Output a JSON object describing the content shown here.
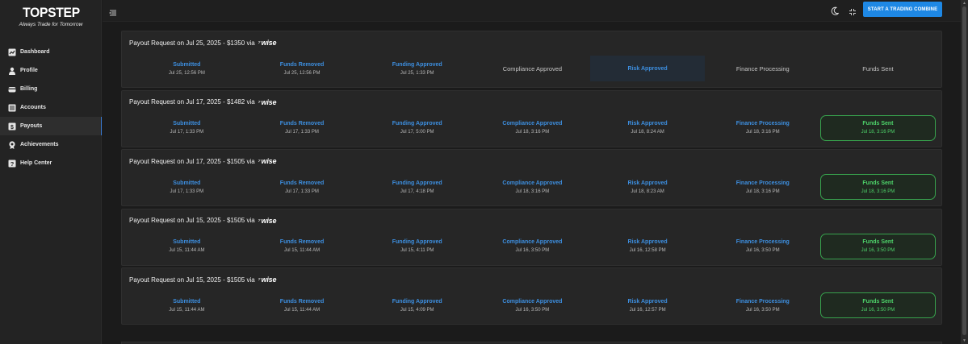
{
  "brand": {
    "name": "TOPSTEP",
    "tagline": "Always Trade for Tomorrow"
  },
  "nav": [
    {
      "label": "Dashboard",
      "icon": "chart-icon",
      "active": false
    },
    {
      "label": "Profile",
      "icon": "user-icon",
      "active": false
    },
    {
      "label": "Billing",
      "icon": "billing-icon",
      "active": false
    },
    {
      "label": "Accounts",
      "icon": "list-icon",
      "active": false
    },
    {
      "label": "Payouts",
      "icon": "payout-icon",
      "active": true
    },
    {
      "label": "Achievements",
      "icon": "badge-icon",
      "active": false
    },
    {
      "label": "Help Center",
      "icon": "help-icon",
      "active": false
    }
  ],
  "topbar": {
    "cta_label": "START A TRADING COMBINE"
  },
  "colors": {
    "accent": "#1e88e5",
    "step_blue": "#3d8fe0",
    "success": "#4ed46a"
  },
  "payouts": [
    {
      "title": "Payout Request on Jul 25, 2025 - $1350 via",
      "method": "wise",
      "steps": [
        {
          "label": "Submitted",
          "time": "Jul 25, 12:56 PM",
          "state": "done"
        },
        {
          "label": "Funds Removed",
          "time": "Jul 25, 12:56 PM",
          "state": "done"
        },
        {
          "label": "Funding Approved",
          "time": "Jul 25, 1:33 PM",
          "state": "done"
        },
        {
          "label": "Compliance Approved",
          "time": "",
          "state": "pending"
        },
        {
          "label": "Risk Approved",
          "time": "",
          "state": "current"
        },
        {
          "label": "Finance Processing",
          "time": "",
          "state": "pending"
        },
        {
          "label": "Funds Sent",
          "time": "",
          "state": "pending"
        }
      ]
    },
    {
      "title": "Payout Request on Jul 17, 2025 - $1482 via",
      "method": "wise",
      "steps": [
        {
          "label": "Submitted",
          "time": "Jul 17, 1:33 PM",
          "state": "done"
        },
        {
          "label": "Funds Removed",
          "time": "Jul 17, 1:33 PM",
          "state": "done"
        },
        {
          "label": "Funding Approved",
          "time": "Jul 17, 5:00 PM",
          "state": "done"
        },
        {
          "label": "Compliance Approved",
          "time": "Jul 18, 3:16 PM",
          "state": "done"
        },
        {
          "label": "Risk Approved",
          "time": "Jul 18, 8:24 AM",
          "state": "done"
        },
        {
          "label": "Finance Processing",
          "time": "Jul 18, 3:16 PM",
          "state": "done"
        },
        {
          "label": "Funds Sent",
          "time": "Jul 18, 3:16 PM",
          "state": "sent"
        }
      ]
    },
    {
      "title": "Payout Request on Jul 17, 2025 - $1505 via",
      "method": "wise",
      "steps": [
        {
          "label": "Submitted",
          "time": "Jul 17, 1:33 PM",
          "state": "done"
        },
        {
          "label": "Funds Removed",
          "time": "Jul 17, 1:33 PM",
          "state": "done"
        },
        {
          "label": "Funding Approved",
          "time": "Jul 17, 4:18 PM",
          "state": "done"
        },
        {
          "label": "Compliance Approved",
          "time": "Jul 18, 3:16 PM",
          "state": "done"
        },
        {
          "label": "Risk Approved",
          "time": "Jul 18, 8:23 AM",
          "state": "done"
        },
        {
          "label": "Finance Processing",
          "time": "Jul 18, 3:16 PM",
          "state": "done"
        },
        {
          "label": "Funds Sent",
          "time": "Jul 18, 3:16 PM",
          "state": "sent"
        }
      ]
    },
    {
      "title": "Payout Request on Jul 15, 2025 - $1505 via",
      "method": "wise",
      "steps": [
        {
          "label": "Submitted",
          "time": "Jul 15, 11:44 AM",
          "state": "done"
        },
        {
          "label": "Funds Removed",
          "time": "Jul 15, 11:44 AM",
          "state": "done"
        },
        {
          "label": "Funding Approved",
          "time": "Jul 15, 4:11 PM",
          "state": "done"
        },
        {
          "label": "Compliance Approved",
          "time": "Jul 16, 3:50 PM",
          "state": "done"
        },
        {
          "label": "Risk Approved",
          "time": "Jul 16, 12:58 PM",
          "state": "done"
        },
        {
          "label": "Finance Processing",
          "time": "Jul 16, 3:50 PM",
          "state": "done"
        },
        {
          "label": "Funds Sent",
          "time": "Jul 16, 3:50 PM",
          "state": "sent"
        }
      ]
    },
    {
      "title": "Payout Request on Jul 15, 2025 - $1505 via",
      "method": "wise",
      "steps": [
        {
          "label": "Submitted",
          "time": "Jul 15, 11:44 AM",
          "state": "done"
        },
        {
          "label": "Funds Removed",
          "time": "Jul 15, 11:44 AM",
          "state": "done"
        },
        {
          "label": "Funding Approved",
          "time": "Jul 15, 4:09 PM",
          "state": "done"
        },
        {
          "label": "Compliance Approved",
          "time": "Jul 16, 3:50 PM",
          "state": "done"
        },
        {
          "label": "Risk Approved",
          "time": "Jul 16, 12:57 PM",
          "state": "done"
        },
        {
          "label": "Finance Processing",
          "time": "Jul 16, 3:50 PM",
          "state": "done"
        },
        {
          "label": "Funds Sent",
          "time": "Jul 16, 3:50 PM",
          "state": "sent"
        }
      ]
    }
  ]
}
